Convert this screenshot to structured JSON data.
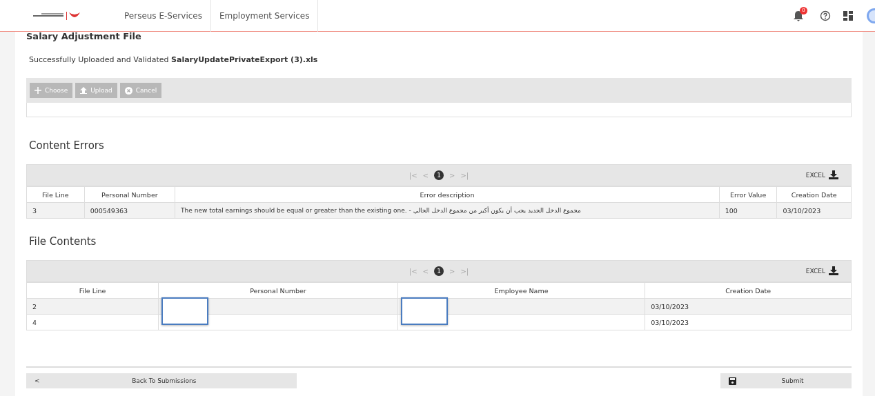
{
  "header": {
    "nav": [
      "Perseus E-Services",
      "Employment Services"
    ],
    "notification_badge": "0"
  },
  "page_title": "Salary Adjustment File",
  "upload": {
    "message": "Successfully Uploaded and Validated **SalaryUpdatePrivateExport (3).xls**",
    "buttons": [
      {
        "label": "Choose",
        "disabled": true
      },
      {
        "label": "Upload",
        "disabled": true
      },
      {
        "label": "Cancel",
        "disabled": true
      }
    ]
  },
  "sections": [
    {
      "title": "Content Errors",
      "pager": {
        "first": "|<",
        "prev": "<",
        "pages": [
          {
            "label": "1",
            "selected": true
          }
        ],
        "next": ">",
        "last": ">|"
      },
      "export": "EXCEL",
      "columns": [
        "File Line",
        "Personal Number",
        "Error description",
        "Error Value",
        "Creation Date"
      ],
      "rows": [
        {
          "cells": [
            "3",
            "000549363",
            "The new total earnings should be equal or greater than the existing one. - مجموع الدخل الجديد يجب أن يكون أكبر من مجموع الدخل الحالي",
            "100",
            "03/10/2023"
          ],
          "redacted": false
        }
      ]
    },
    {
      "title": "File Contents",
      "pager": {
        "first": "|<",
        "prev": "<",
        "pages": [
          {
            "label": "1",
            "selected": true
          }
        ],
        "next": ">",
        "last": ">|"
      },
      "export": "EXCEL",
      "columns": [
        "File Line",
        "Personal Number",
        "Employee Name",
        "Creation Date"
      ],
      "rows": [
        {
          "cells": [
            "2",
            "",
            "",
            "03/10/2023"
          ],
          "redacted": true
        },
        {
          "cells": [
            "4",
            "",
            "",
            "03/10/2023"
          ],
          "redacted": false
        }
      ]
    }
  ],
  "footer": {
    "back": {
      "icon": "<",
      "label": "Back To Submissions"
    },
    "submit": {
      "label": "Submit"
    }
  }
}
